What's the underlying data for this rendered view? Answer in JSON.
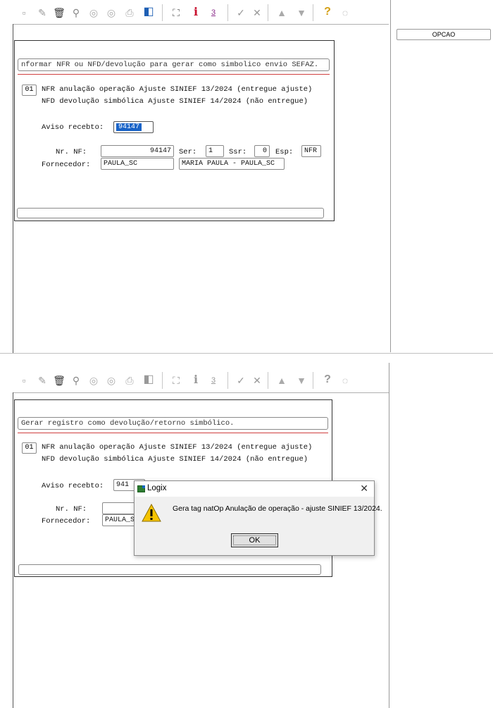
{
  "toolbar": {
    "icons": [
      "new-icon",
      "edit-icon",
      "delete-icon",
      "search-icon",
      "previous-icon",
      "next-icon",
      "print-icon",
      "exit-icon",
      "binoculars-icon",
      "info-icon",
      "report-icon",
      "check-icon",
      "tools-icon",
      "up-icon",
      "down-icon",
      "help-icon",
      "comment-icon"
    ]
  },
  "side": {
    "opcao": "OPCAO"
  },
  "screen1": {
    "message": "nformar NFR ou NFD/devolução para gerar como simbolico envio SEFAZ.",
    "option_code": "01",
    "option_line1": "NFR anulação operação Ajuste SINIEF 13/2024 (entregue ajuste)",
    "option_line2": "NFD devolução simbólica Ajuste SINIEF 14/2024 (não entregue)",
    "aviso_label": "Aviso recebto:",
    "aviso_value": "94147",
    "nf_label": "Nr. NF:",
    "nf_value": "94147",
    "ser_label": "Ser:",
    "ser_value": "1",
    "ssr_label": "Ssr:",
    "ssr_value": "0",
    "esp_label": "Esp:",
    "esp_value": "NFR",
    "fornecedor_label": "Fornecedor:",
    "fornecedor_code": "PAULA_SC",
    "fornecedor_name": "MARIA PAULA - PAULA_SC"
  },
  "screen2": {
    "message": "Gerar registro como devolução/retorno simbólico.",
    "option_code": "01",
    "option_line1": "NFR anulação operação Ajuste SINIEF 13/2024 (entregue ajuste)",
    "option_line2": "NFD devolução simbólica Ajuste SINIEF 14/2024 (não entregue)",
    "aviso_label": "Aviso recebto:",
    "aviso_partial": "941",
    "nf_label": "Nr. NF:",
    "fornecedor_label": "Fornecedor:",
    "fornecedor_partial": "PAULA_S"
  },
  "dialog": {
    "title": "Logix",
    "close": "✕",
    "message": "Gera tag natOp Anulação de operação - ajuste SINIEF 13/2024.",
    "ok": "OK"
  }
}
